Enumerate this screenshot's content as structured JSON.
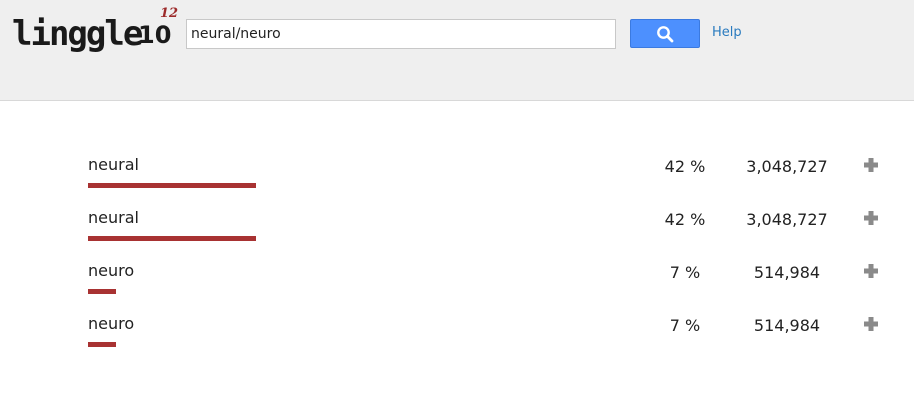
{
  "logo": {
    "text": "linggle",
    "ten": "10",
    "exponent": "12"
  },
  "search": {
    "value": "neural/neuro",
    "button_icon": "search-icon"
  },
  "help_label": "Help",
  "results": [
    {
      "word": "neural",
      "percent": "42 %",
      "count": "3,048,727",
      "share": 0.42,
      "expand_icon": "plus-icon"
    },
    {
      "word": "neural",
      "percent": "42 %",
      "count": "3,048,727",
      "share": 0.42,
      "expand_icon": "plus-icon"
    },
    {
      "word": "neuro",
      "percent": "7 %",
      "count": "514,984",
      "share": 0.07,
      "expand_icon": "plus-icon"
    },
    {
      "word": "neuro",
      "percent": "7 %",
      "count": "514,984",
      "share": 0.07,
      "expand_icon": "plus-icon"
    }
  ],
  "colors": {
    "bar": "#a83232",
    "button": "#4d90fe",
    "link": "#2a7bbf",
    "header_bg": "#efefef"
  }
}
